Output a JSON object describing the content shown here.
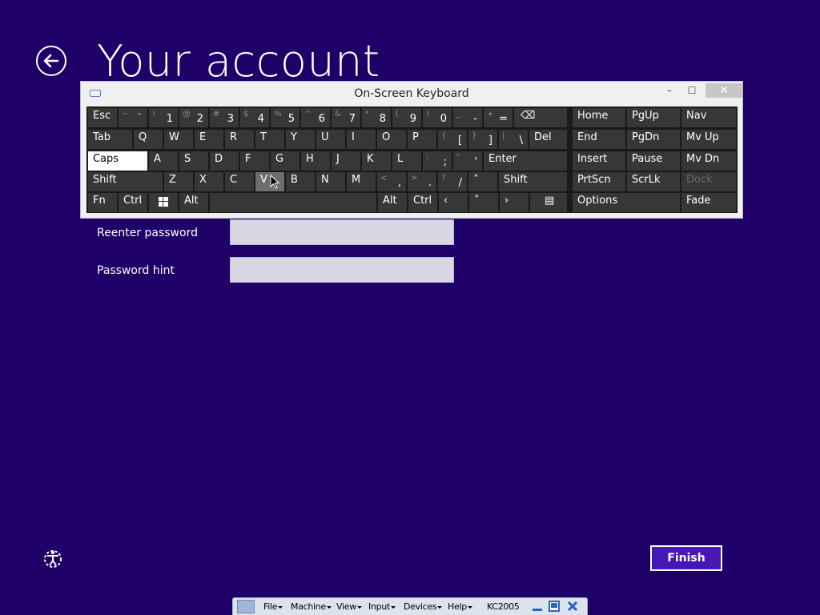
{
  "page": {
    "title": "Your account"
  },
  "fields": {
    "reenter_password_label": "Reenter password",
    "password_hint_label": "Password hint",
    "reenter_password_value": "",
    "password_hint_value": ""
  },
  "buttons": {
    "finish": "Finish"
  },
  "colors": {
    "background": "#1f0068",
    "accent": "#4617b4",
    "keyboard_key": "#373737"
  },
  "osk": {
    "title": "On-Screen Keyboard",
    "window_controls": {
      "minimize": "–",
      "maximize": "☐",
      "close": "✕"
    },
    "keys": {
      "esc": "Esc",
      "tab": "Tab",
      "caps": "Caps",
      "shift": "Shift",
      "shift_r": "Shift",
      "fn": "Fn",
      "ctrl": "Ctrl",
      "alt": "Alt",
      "alt_r": "Alt",
      "ctrl_r": "Ctrl",
      "del": "Del",
      "enter": "Enter",
      "home": "Home",
      "pgup": "PgUp",
      "nav": "Nav",
      "end": "End",
      "pgdn": "PgDn",
      "mvup": "Mv Up",
      "insert": "Insert",
      "pause": "Pause",
      "mvdn": "Mv Dn",
      "prtscn": "PrtScn",
      "scrlk": "ScrLk",
      "dock": "Dock",
      "options": "Options",
      "fade": "Fade",
      "backspace_glyph": "⌫",
      "arrow_left": "‹",
      "arrow_up": "˄",
      "arrow_down": "˅",
      "arrow_right": "›",
      "menu_glyph": "▤",
      "number_row": [
        {
          "shift": "~",
          "main": "`"
        },
        {
          "shift": "!",
          "main": "1"
        },
        {
          "shift": "@",
          "main": "2"
        },
        {
          "shift": "#",
          "main": "3"
        },
        {
          "shift": "$",
          "main": "4"
        },
        {
          "shift": "%",
          "main": "5"
        },
        {
          "shift": "^",
          "main": "6"
        },
        {
          "shift": "&",
          "main": "7"
        },
        {
          "shift": "*",
          "main": "8"
        },
        {
          "shift": "(",
          "main": "9"
        },
        {
          "shift": ")",
          "main": "0"
        },
        {
          "shift": "_",
          "main": "-"
        },
        {
          "shift": "+",
          "main": "="
        }
      ],
      "row_q": [
        "Q",
        "W",
        "E",
        "R",
        "T",
        "Y",
        "U",
        "I",
        "O",
        "P"
      ],
      "row_q_symbols": [
        {
          "shift": "{",
          "main": "["
        },
        {
          "shift": "}",
          "main": "]"
        },
        {
          "shift": "|",
          "main": "\\"
        }
      ],
      "row_a": [
        "A",
        "S",
        "D",
        "F",
        "G",
        "H",
        "J",
        "K",
        "L"
      ],
      "row_a_symbols": [
        {
          "shift": ":",
          "main": ";"
        },
        {
          "shift": "\"",
          "main": "'"
        }
      ],
      "row_z": [
        "Z",
        "X",
        "C",
        "V",
        "B",
        "N",
        "M"
      ],
      "row_z_symbols": [
        {
          "shift": "<",
          "main": ","
        },
        {
          "shift": ">",
          "main": "."
        },
        {
          "shift": "?",
          "main": "/"
        }
      ]
    }
  },
  "vm_bar": {
    "menus": [
      "File",
      "Machine",
      "View",
      "Input",
      "Devices",
      "Help"
    ],
    "machine_name": "KC2005"
  }
}
